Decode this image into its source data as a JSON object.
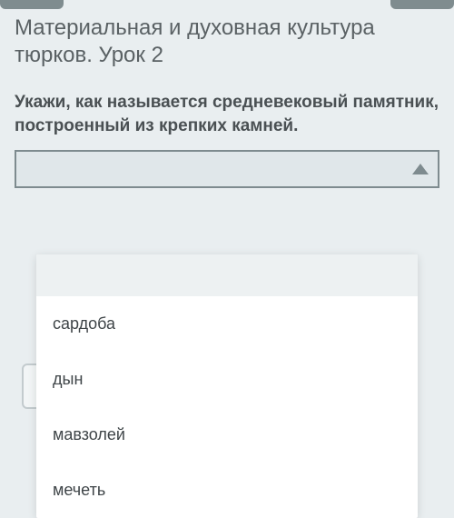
{
  "lesson": {
    "title": "Материальная и духовная культура тюрков. Урок 2"
  },
  "question": {
    "prompt": "Укажи, как называется средневековый памятник, построенный из крепких камней."
  },
  "select": {
    "selected": ""
  },
  "dropdown": {
    "options": [
      "сардоба",
      "дын",
      "мавзолей",
      "мечеть"
    ]
  }
}
